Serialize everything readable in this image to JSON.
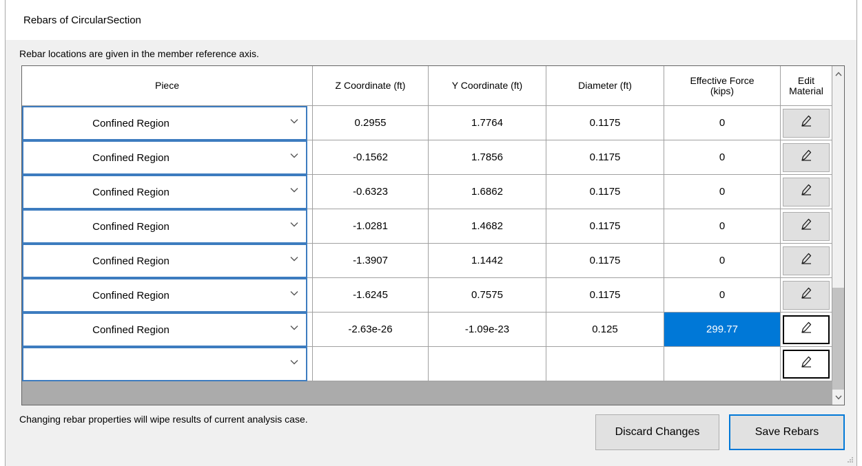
{
  "window": {
    "title": "Rebars of CircularSection"
  },
  "info_text": "Rebar locations are given in the member reference axis.",
  "table": {
    "headers": {
      "piece": "Piece",
      "z": "Z Coordinate (ft)",
      "y": "Y Coordinate (ft)",
      "diameter": "Diameter (ft)",
      "force": "Effective Force\n(kips)",
      "edit": "Edit\nMaterial"
    },
    "rows": [
      {
        "piece": "Confined Region",
        "z": "0.2955",
        "y": "1.7764",
        "diameter": "0.1175",
        "force": "0"
      },
      {
        "piece": "Confined Region",
        "z": "-0.1562",
        "y": "1.7856",
        "diameter": "0.1175",
        "force": "0"
      },
      {
        "piece": "Confined Region",
        "z": "-0.6323",
        "y": "1.6862",
        "diameter": "0.1175",
        "force": "0"
      },
      {
        "piece": "Confined Region",
        "z": "-1.0281",
        "y": "1.4682",
        "diameter": "0.1175",
        "force": "0"
      },
      {
        "piece": "Confined Region",
        "z": "-1.3907",
        "y": "1.1442",
        "diameter": "0.1175",
        "force": "0"
      },
      {
        "piece": "Confined Region",
        "z": "-1.6245",
        "y": "0.7575",
        "diameter": "0.1175",
        "force": "0"
      },
      {
        "piece": "Confined Region",
        "z": "-2.63e-26",
        "y": "-1.09e-23",
        "diameter": "0.125",
        "force": "299.77"
      },
      {
        "piece": "",
        "z": "",
        "y": "",
        "diameter": "",
        "force": ""
      }
    ]
  },
  "warning_text": "Changing rebar properties will wipe results of current analysis case.",
  "buttons": {
    "discard": "Discard Changes",
    "save": "Save Rebars"
  },
  "colors": {
    "selection": "#0078d7",
    "combo_border": "#3d7cbf",
    "grid_background": "#ababab"
  },
  "icons": {
    "edit": "pencil-icon",
    "dropdown": "chevron-down-icon",
    "scroll_up": "chevron-up-icon",
    "scroll_down": "chevron-down-icon",
    "grip": "resize-grip-icon"
  }
}
